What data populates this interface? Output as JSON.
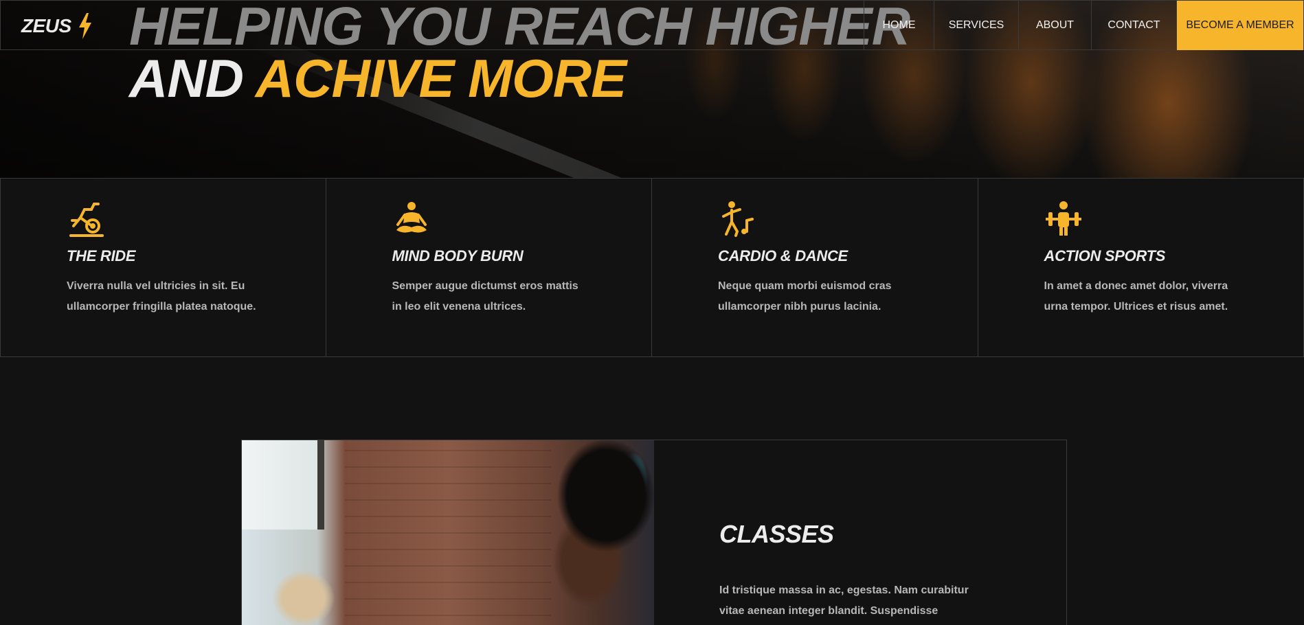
{
  "brand": {
    "name": "ZEUS",
    "accent_color": "#f7b52c",
    "logo_icon": "lightning-bolt-icon"
  },
  "hero": {
    "line1": "HELPING YOU REACH HIGHER",
    "line2_white": "AND",
    "line2_accent": "ACHIVE MORE"
  },
  "nav": {
    "items": [
      "HOME",
      "SERVICES",
      "ABOUT",
      "CONTACT"
    ],
    "cta": "BECOME A MEMBER"
  },
  "features": [
    {
      "icon": "exercise-bike-icon",
      "title": "THE RIDE",
      "text": "Viverra nulla vel ultricies in sit. Eu ullamcorper fringilla platea natoque."
    },
    {
      "icon": "meditation-icon",
      "title": "MIND BODY BURN",
      "text": "Semper augue dictumst eros mattis in leo elit venena ultrices."
    },
    {
      "icon": "dance-icon",
      "title": "CARDIO & DANCE",
      "text": "Neque quam morbi euismod cras ullamcorper nibh purus lacinia."
    },
    {
      "icon": "weightlifting-icon",
      "title": "ACTION SPORTS",
      "text": "In amet a donec amet dolor, viverra urna tempor. Ultrices et risus amet."
    }
  ],
  "classes": {
    "title": "CLASSES",
    "text": "Id tristique massa in ac, egestas. Nam curabitur vitae aenean integer blandit. Suspendisse"
  }
}
